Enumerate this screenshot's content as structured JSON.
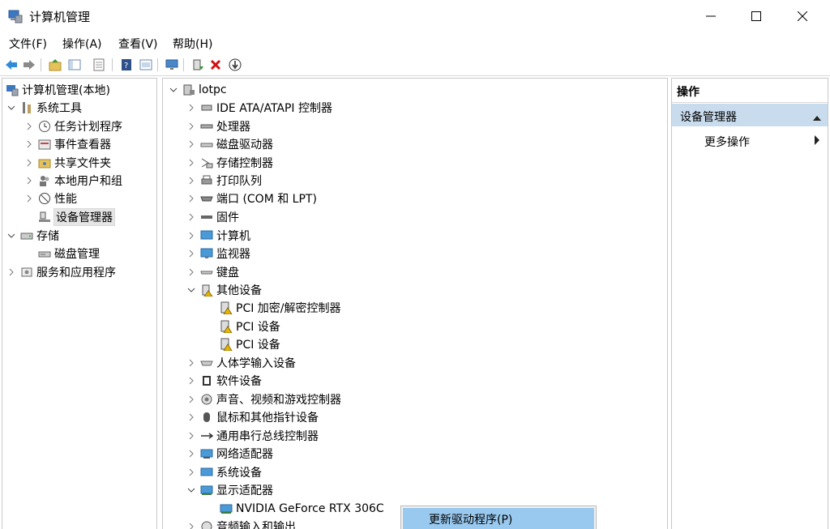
{
  "window": {
    "title": "计算机管理"
  },
  "menu": [
    "文件(F)",
    "操作(A)",
    "查看(V)",
    "帮助(H)"
  ],
  "toolbar": [
    "back-icon",
    "forward-icon",
    "up-folder-icon",
    "show-hide-tree-icon",
    "export-list-icon",
    "help-icon",
    "properties-icon",
    "monitor-icon",
    "update-driver-icon",
    "uninstall-icon",
    "disable-icon"
  ],
  "left_tree": {
    "root": "计算机管理(本地)",
    "system_tools": "系统工具",
    "task_scheduler": "任务计划程序",
    "event_viewer": "事件查看器",
    "shared_folders": "共享文件夹",
    "local_users": "本地用户和组",
    "performance": "性能",
    "device_manager": "设备管理器",
    "storage": "存储",
    "disk_management": "磁盘管理",
    "services_apps": "服务和应用程序"
  },
  "devices": {
    "computer": "lotpc",
    "categories": [
      "IDE ATA/ATAPI 控制器",
      "处理器",
      "磁盘驱动器",
      "存储控制器",
      "打印队列",
      "端口 (COM 和 LPT)",
      "固件",
      "计算机",
      "监视器",
      "键盘",
      "其他设备",
      "PCI 加密/解密控制器",
      "PCI 设备",
      "PCI 设备",
      "人体学输入设备",
      "软件设备",
      "声音、视频和游戏控制器",
      "鼠标和其他指针设备",
      "通用串行总线控制器",
      "网络适配器",
      "系统设备",
      "显示适配器",
      "NVIDIA GeForce RTX 306C",
      "音频输入和输出"
    ]
  },
  "actions": {
    "header": "操作",
    "section": "设备管理器",
    "more": "更多操作"
  },
  "context_menu": {
    "update_driver": "更新驱动程序(P)"
  },
  "colors": {
    "selection": "#99c9ef",
    "action_section": "#c9dcee",
    "warning": "#e8b600"
  }
}
